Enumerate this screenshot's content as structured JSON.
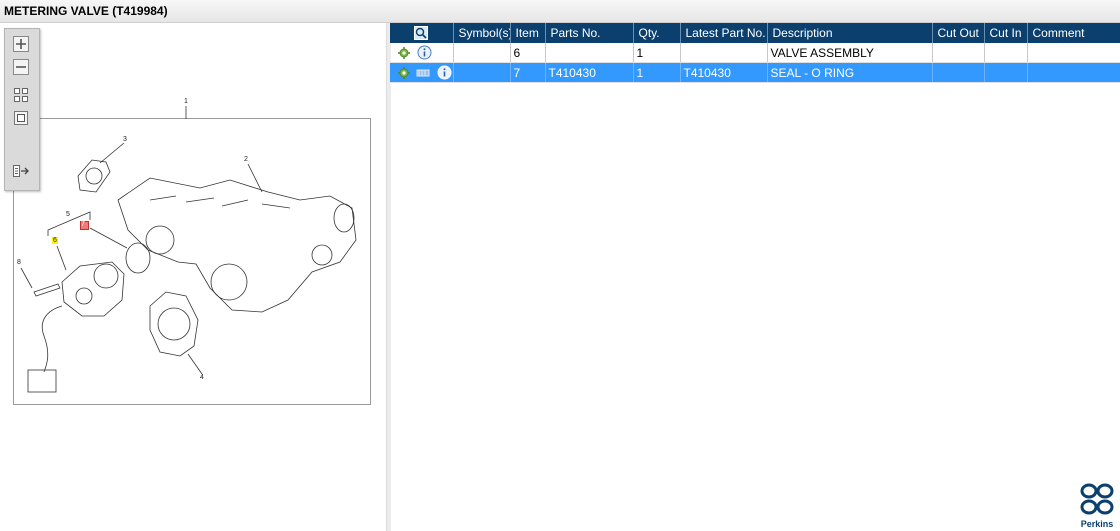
{
  "window": {
    "title": "METERING VALVE (T419984)"
  },
  "toolbar": {
    "buttons": [
      {
        "name": "zoom-in-button",
        "icon": "plus-icon"
      },
      {
        "name": "zoom-out-button",
        "icon": "minus-icon"
      },
      {
        "name": "fit-all-button",
        "icon": "grid-icon"
      },
      {
        "name": "actual-size-button",
        "icon": "square-icon"
      },
      {
        "name": "expand-panel-button",
        "icon": "panel-arrow-icon"
      }
    ]
  },
  "diagram": {
    "callouts": {
      "c1": "1",
      "c2": "2",
      "c3": "3",
      "c4": "4",
      "c5": "5",
      "c6": "6",
      "c7": "7",
      "c8": "8"
    },
    "highlight_color": "#fff200"
  },
  "table": {
    "headers": {
      "icon_col": "magnifier-icon",
      "symbols": "Symbol(s)",
      "item": "Item",
      "parts_no": "Parts No.",
      "qty": "Qty.",
      "latest": "Latest Part No.",
      "description": "Description",
      "cut_out": "Cut Out",
      "cut_in": "Cut In",
      "comment": "Comment"
    },
    "rows": [
      {
        "item": "6",
        "parts_no": "",
        "qty": "1",
        "latest": "",
        "description": "VALVE ASSEMBLY",
        "cut_out": "",
        "cut_in": "",
        "comment": "",
        "selected": false,
        "icons": [
          "gear-icon",
          "info-icon"
        ]
      },
      {
        "item": "7",
        "parts_no": "T410430",
        "qty": "1",
        "latest": "T410430",
        "description": "SEAL - O RING",
        "cut_out": "",
        "cut_in": "",
        "comment": "",
        "selected": true,
        "icons": [
          "gear-icon",
          "stock-icon",
          "info-icon"
        ]
      }
    ]
  },
  "brand": {
    "name": "Perkins",
    "color": "#0b3f6e",
    "header_color": "#0b3f6e",
    "selection_color": "#3399ff"
  }
}
